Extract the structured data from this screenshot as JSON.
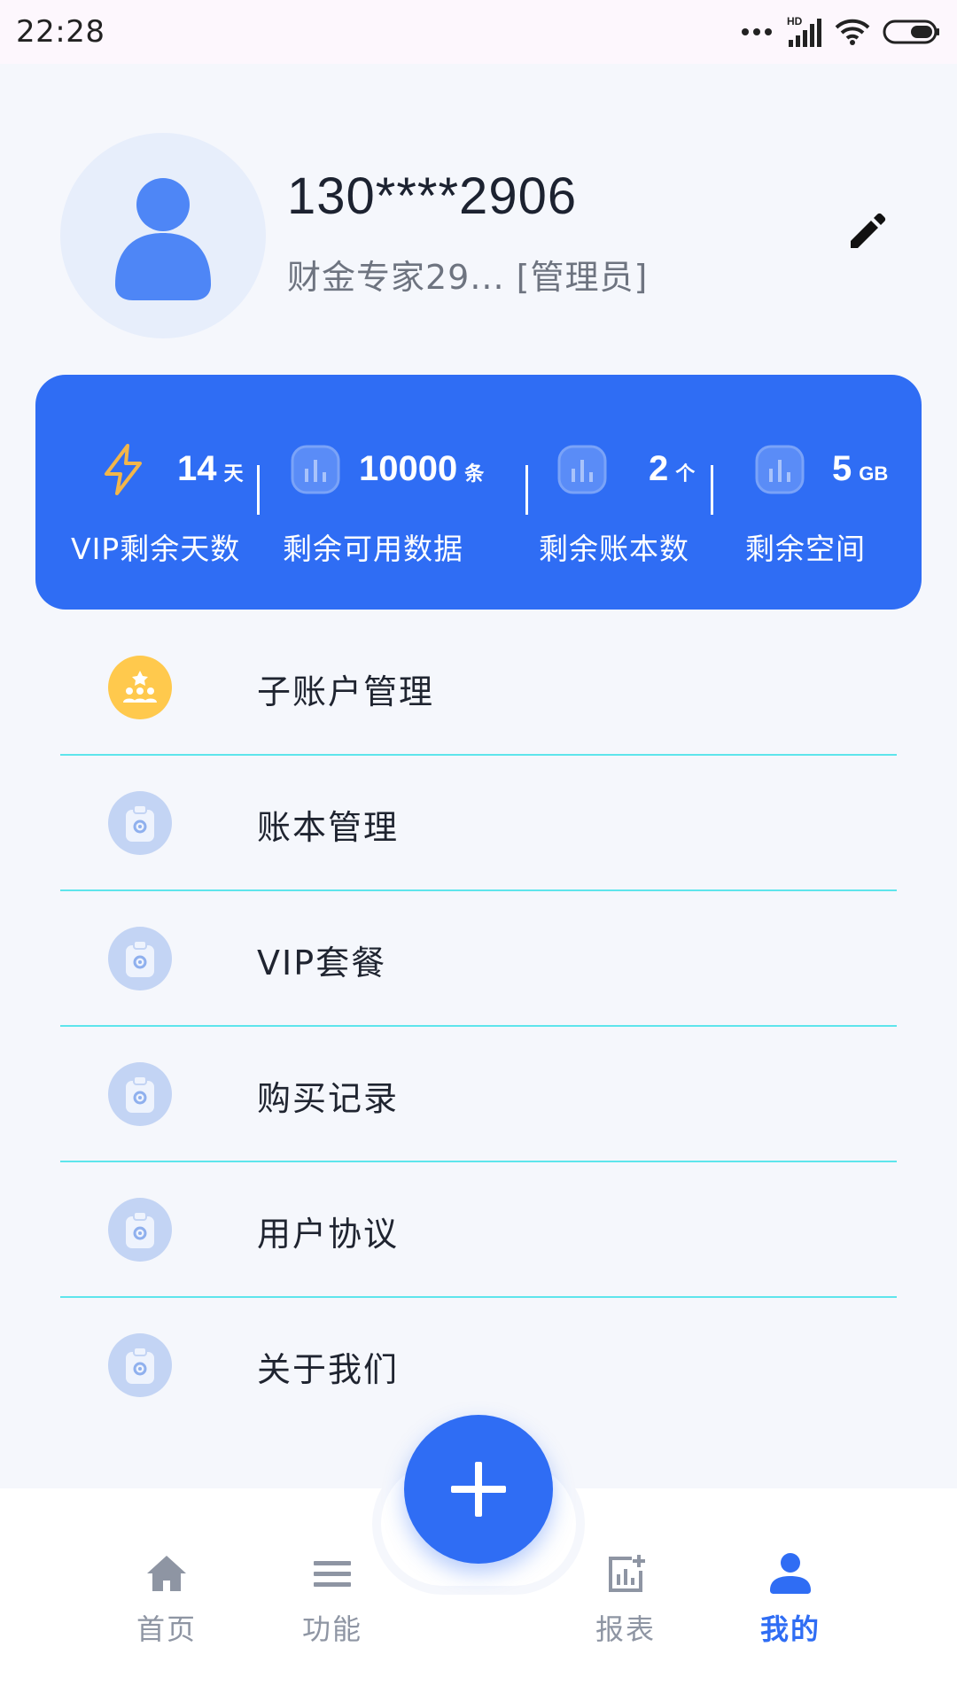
{
  "status_bar": {
    "time": "22:28",
    "hd_label": "HD"
  },
  "profile": {
    "phone": "130****2906",
    "role_text": "财金专家29... [管理员]"
  },
  "stats": [
    {
      "value": "14",
      "unit": "天",
      "label": "VIP剩余天数",
      "icon": "lightning-icon"
    },
    {
      "value": "10000",
      "unit": "条",
      "label": "剩余可用数据",
      "icon": "bar-chart-icon"
    },
    {
      "value": "2",
      "unit": "个",
      "label": "剩余账本数",
      "icon": "bar-chart-icon"
    },
    {
      "value": "5",
      "unit": "GB",
      "label": "剩余空间",
      "icon": "bar-chart-icon"
    }
  ],
  "menu": [
    {
      "label": "子账户管理",
      "icon": "team-icon"
    },
    {
      "label": "账本管理",
      "icon": "clipboard-gear-icon"
    },
    {
      "label": "VIP套餐",
      "icon": "clipboard-gear-icon"
    },
    {
      "label": "购买记录",
      "icon": "clipboard-gear-icon"
    },
    {
      "label": "用户协议",
      "icon": "clipboard-gear-icon"
    },
    {
      "label": "关于我们",
      "icon": "clipboard-gear-icon"
    }
  ],
  "nav": {
    "home": "首页",
    "functions": "功能",
    "reports": "报表",
    "mine": "我的",
    "active": "mine"
  },
  "colors": {
    "primary": "#2f6df4",
    "divider": "#5ee5ec",
    "gold": "#ffc94d"
  }
}
